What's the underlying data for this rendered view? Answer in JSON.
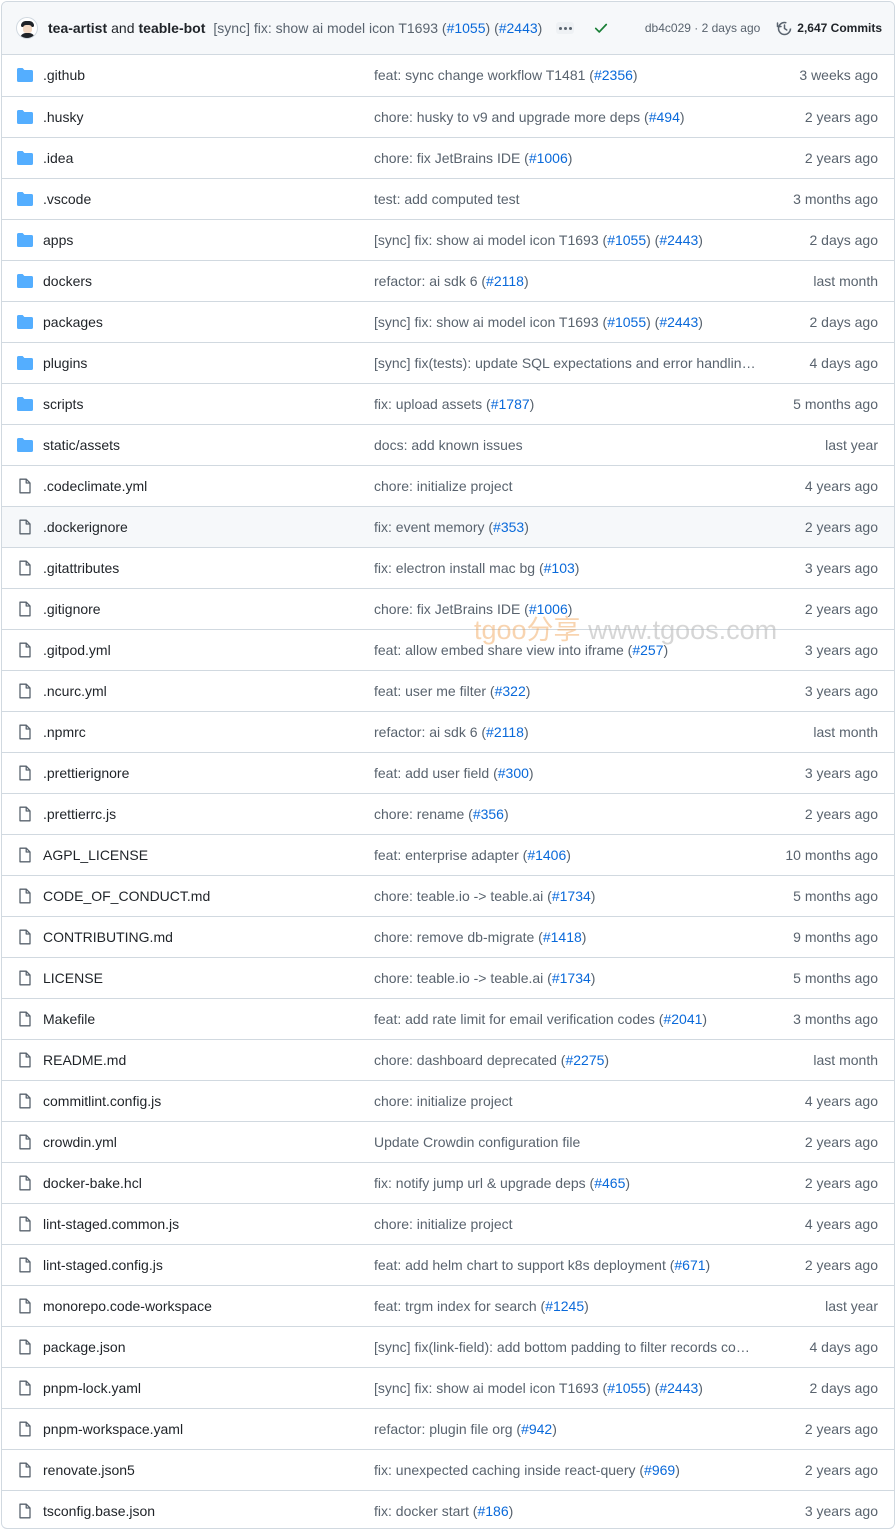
{
  "header": {
    "author1": "tea-artist",
    "conjunction": "and",
    "author2": "teable-bot",
    "commit_prefix": "[sync] fix: show ai model icon T1693 (",
    "commit_link1": "#1055",
    "commit_mid": ") (",
    "commit_link2": "#2443",
    "commit_suffix": ")",
    "sha": "db4c029 · 2 days ago",
    "commits_label": "2,647 Commits"
  },
  "colors": {
    "folder": "#54aeff",
    "link": "#0969da",
    "muted": "#59636e",
    "success": "#1a7f37"
  },
  "watermark": {
    "brand": "tgoo分享",
    "url": "www.tgoos.com"
  },
  "files": [
    {
      "name": ".github",
      "type": "dir",
      "msg": "feat: sync change workflow T1481 (",
      "link": "#2356",
      "msg_end": ")",
      "age": "3 weeks ago"
    },
    {
      "name": ".husky",
      "type": "dir",
      "msg": "chore: husky to v9 and upgrade more deps (",
      "link": "#494",
      "msg_end": ")",
      "age": "2 years ago"
    },
    {
      "name": ".idea",
      "type": "dir",
      "msg": "chore: fix JetBrains IDE (",
      "link": "#1006",
      "msg_end": ")",
      "age": "2 years ago"
    },
    {
      "name": ".vscode",
      "type": "dir",
      "msg": "test: add computed test",
      "link": "",
      "msg_end": "",
      "age": "3 months ago"
    },
    {
      "name": "apps",
      "type": "dir",
      "msg": "[sync] fix: show ai model icon T1693 (",
      "link": "#1055",
      "msg_mid": ") (",
      "link2": "#2443",
      "msg_end": ")",
      "age": "2 days ago"
    },
    {
      "name": "dockers",
      "type": "dir",
      "msg": "refactor: ai sdk 6 (",
      "link": "#2118",
      "msg_end": ")",
      "age": "last month"
    },
    {
      "name": "packages",
      "type": "dir",
      "msg": "[sync] fix: show ai model icon T1693 (",
      "link": "#1055",
      "msg_mid": ") (",
      "link2": "#2443",
      "msg_end": ")",
      "age": "2 days ago"
    },
    {
      "name": "plugins",
      "type": "dir",
      "msg": "[sync] fix(tests): update SQL expectations and error handling…",
      "link": "",
      "msg_end": "",
      "age": "4 days ago"
    },
    {
      "name": "scripts",
      "type": "dir",
      "msg": "fix: upload assets (",
      "link": "#1787",
      "msg_end": ")",
      "age": "5 months ago"
    },
    {
      "name": "static/assets",
      "type": "dir",
      "msg": "docs: add known issues",
      "link": "",
      "msg_end": "",
      "age": "last year"
    },
    {
      "name": ".codeclimate.yml",
      "type": "file",
      "msg": "chore: initialize project",
      "link": "",
      "msg_end": "",
      "age": "4 years ago"
    },
    {
      "name": ".dockerignore",
      "type": "file",
      "msg": "fix: event memory (",
      "link": "#353",
      "msg_end": ")",
      "age": "2 years ago",
      "highlight": true
    },
    {
      "name": ".gitattributes",
      "type": "file",
      "msg": "fix: electron install mac bg (",
      "link": "#103",
      "msg_end": ")",
      "age": "3 years ago"
    },
    {
      "name": ".gitignore",
      "type": "file",
      "msg": "chore: fix JetBrains IDE (",
      "link": "#1006",
      "msg_end": ")",
      "age": "2 years ago"
    },
    {
      "name": ".gitpod.yml",
      "type": "file",
      "msg": "feat: allow embed share view into iframe (",
      "link": "#257",
      "msg_end": ")",
      "age": "3 years ago"
    },
    {
      "name": ".ncurc.yml",
      "type": "file",
      "msg": "feat: user me filter (",
      "link": "#322",
      "msg_end": ")",
      "age": "3 years ago"
    },
    {
      "name": ".npmrc",
      "type": "file",
      "msg": "refactor: ai sdk 6 (",
      "link": "#2118",
      "msg_end": ")",
      "age": "last month"
    },
    {
      "name": ".prettierignore",
      "type": "file",
      "msg": "feat: add user field (",
      "link": "#300",
      "msg_end": ")",
      "age": "3 years ago"
    },
    {
      "name": ".prettierrc.js",
      "type": "file",
      "msg": "chore: rename (",
      "link": "#356",
      "msg_end": ")",
      "age": "2 years ago"
    },
    {
      "name": "AGPL_LICENSE",
      "type": "file",
      "msg": "feat: enterprise adapter (",
      "link": "#1406",
      "msg_end": ")",
      "age": "10 months ago"
    },
    {
      "name": "CODE_OF_CONDUCT.md",
      "type": "file",
      "msg": "chore: teable.io -> teable.ai (",
      "link": "#1734",
      "msg_end": ")",
      "age": "5 months ago"
    },
    {
      "name": "CONTRIBUTING.md",
      "type": "file",
      "msg": "chore: remove db-migrate (",
      "link": "#1418",
      "msg_end": ")",
      "age": "9 months ago"
    },
    {
      "name": "LICENSE",
      "type": "file",
      "msg": "chore: teable.io -> teable.ai (",
      "link": "#1734",
      "msg_end": ")",
      "age": "5 months ago"
    },
    {
      "name": "Makefile",
      "type": "file",
      "msg": "feat: add rate limit for email verification codes (",
      "link": "#2041",
      "msg_end": ")",
      "age": "3 months ago"
    },
    {
      "name": "README.md",
      "type": "file",
      "msg": "chore: dashboard deprecated (",
      "link": "#2275",
      "msg_end": ")",
      "age": "last month"
    },
    {
      "name": "commitlint.config.js",
      "type": "file",
      "msg": "chore: initialize project",
      "link": "",
      "msg_end": "",
      "age": "4 years ago"
    },
    {
      "name": "crowdin.yml",
      "type": "file",
      "msg": "Update Crowdin configuration file",
      "link": "",
      "msg_end": "",
      "age": "2 years ago"
    },
    {
      "name": "docker-bake.hcl",
      "type": "file",
      "msg": "fix: notify jump url & upgrade deps (",
      "link": "#465",
      "msg_end": ")",
      "age": "2 years ago"
    },
    {
      "name": "lint-staged.common.js",
      "type": "file",
      "msg": "chore: initialize project",
      "link": "",
      "msg_end": "",
      "age": "4 years ago"
    },
    {
      "name": "lint-staged.config.js",
      "type": "file",
      "msg": "feat: add helm chart to support k8s deployment (",
      "link": "#671",
      "msg_end": ")",
      "age": "2 years ago"
    },
    {
      "name": "monorepo.code-workspace",
      "type": "file",
      "msg": "feat: trgm index for search (",
      "link": "#1245",
      "msg_end": ")",
      "age": "last year"
    },
    {
      "name": "package.json",
      "type": "file",
      "msg": "[sync] fix(link-field): add bottom padding to filter records co…",
      "link": "",
      "msg_end": "",
      "age": "4 days ago"
    },
    {
      "name": "pnpm-lock.yaml",
      "type": "file",
      "msg": "[sync] fix: show ai model icon T1693 (",
      "link": "#1055",
      "msg_mid": ") (",
      "link2": "#2443",
      "msg_end": ")",
      "age": "2 days ago"
    },
    {
      "name": "pnpm-workspace.yaml",
      "type": "file",
      "msg": "refactor: plugin file org (",
      "link": "#942",
      "msg_end": ")",
      "age": "2 years ago"
    },
    {
      "name": "renovate.json5",
      "type": "file",
      "msg": "fix: unexpected caching inside react-query (",
      "link": "#969",
      "msg_end": ")",
      "age": "2 years ago"
    },
    {
      "name": "tsconfig.base.json",
      "type": "file",
      "msg": "fix: docker start (",
      "link": "#186",
      "msg_end": ")",
      "age": "3 years ago"
    }
  ]
}
